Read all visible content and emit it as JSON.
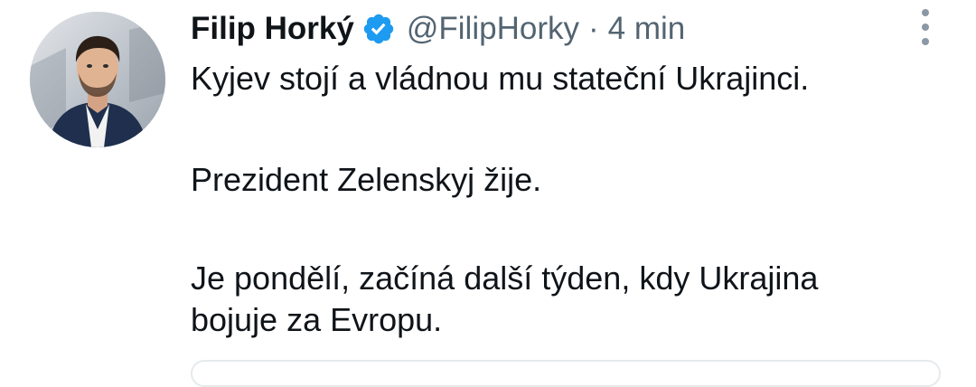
{
  "tweet": {
    "author": {
      "display_name": "Filip Horký",
      "handle": "@FilipHorky",
      "verified_icon": "verified-badge-icon",
      "verified_color": "#1d9bf0"
    },
    "separator": "·",
    "timestamp": "4 min",
    "more_icon": "more-vertical-icon",
    "text": {
      "line1": "Kyjev stojí a vládnou mu stateční Ukrajinci.",
      "line2": "Prezident Zelenskyj žije.",
      "line3": "Je pondělí, začíná další týden, kdy Ukrajina bojuje za Evropu."
    }
  }
}
